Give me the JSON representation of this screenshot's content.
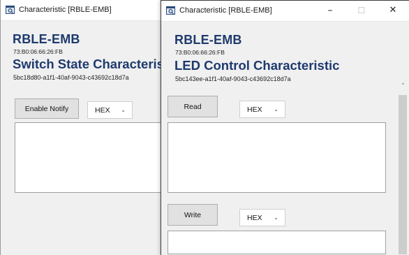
{
  "left_window": {
    "title": "Characteristic [RBLE-EMB]",
    "device_name": "RBLE-EMB",
    "device_address": "73:B0:06:66:26:FB",
    "characteristic_name": "Switch State Characteristic",
    "characteristic_uuid": "5bc18d80-a1f1-40af-9043-c43692c18d7a",
    "enable_notify_label": "Enable Notify",
    "format_select": "HEX",
    "data_field_value": ""
  },
  "right_window": {
    "title": "Characteristic [RBLE-EMB]",
    "controls": {
      "minimize": "–",
      "maximize": "☐",
      "close": "✕"
    },
    "device_name": "RBLE-EMB",
    "device_address": "73:B0:06:66:26:FB",
    "characteristic_name": "LED Control Characteristic",
    "characteristic_uuid": "5bc143ee-a1f1-40af-9043-c43692c18d7a",
    "read_label": "Read",
    "read_format_select": "HEX",
    "read_field_value": "",
    "write_label": "Write",
    "write_format_select": "HEX",
    "write_field_value": ""
  },
  "icons": {
    "app": "app-icon",
    "chevron": "⌄",
    "scroll_up": "˄"
  },
  "colors": {
    "heading": "#1e3a6e",
    "window_bg": "#f0f0f0",
    "titlebar_bg": "#ffffff",
    "button_bg": "#e1e1e1"
  }
}
